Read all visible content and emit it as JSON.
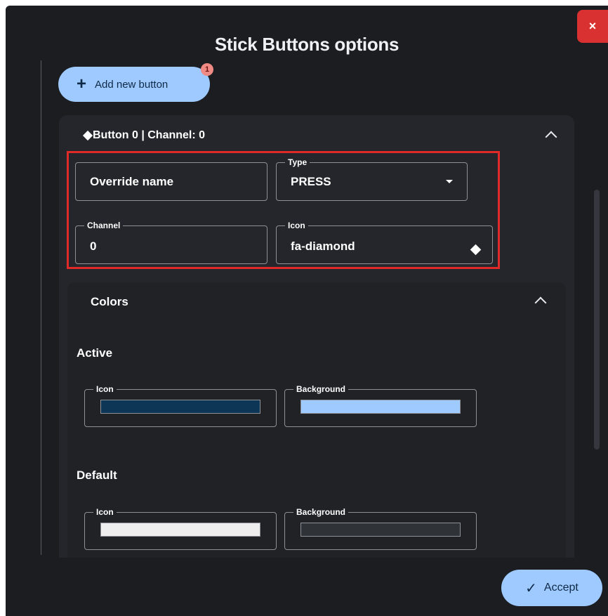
{
  "dialog": {
    "title": "Stick Buttons options",
    "close_label": "×"
  },
  "toolbar": {
    "add_button_label": "Add new button",
    "add_button_icon": "plus-icon",
    "badge_count": "1"
  },
  "button_panel": {
    "header": "Button 0 | Channel: 0",
    "header_icon": "diamond-icon",
    "fields": {
      "override_name": {
        "placeholder": "Override name"
      },
      "type": {
        "label": "Type",
        "value": "PRESS",
        "options": [
          "PRESS"
        ]
      },
      "channel": {
        "label": "Channel",
        "value": "0"
      },
      "icon": {
        "label": "Icon",
        "value": "fa-diamond"
      }
    }
  },
  "colors": {
    "title": "Colors",
    "active": {
      "title": "Active",
      "icon_label": "Icon",
      "icon_color": "#0d3556",
      "background_label": "Background",
      "background_color": "#9ecaff"
    },
    "default": {
      "title": "Default",
      "icon_label": "Icon",
      "icon_color": "#eeeeee",
      "background_label": "Background",
      "background_color": "#2f3236"
    }
  },
  "footer": {
    "accept_label": "Accept"
  },
  "theme": {
    "accent": "#9ecaff",
    "danger": "#d93131",
    "highlight": "#e02a2a"
  }
}
